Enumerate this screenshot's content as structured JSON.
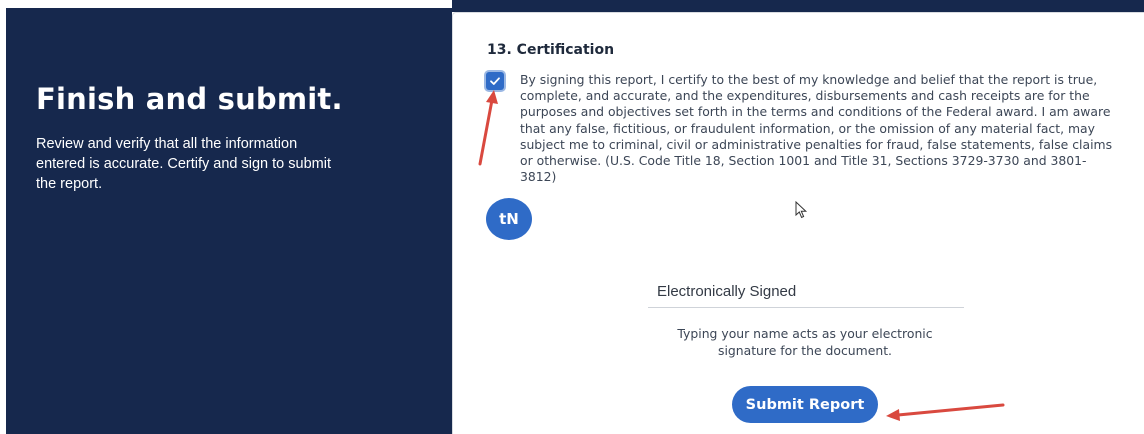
{
  "left": {
    "title": "Finish and submit.",
    "description": "Review and verify that all the information entered is accurate. Certify and sign to submit the report."
  },
  "certification": {
    "section_title": "13. Certification",
    "checked": true,
    "text": "By signing this report, I certify to the best of my knowledge and belief that the report is true, complete, and accurate, and the expenditures, disbursements and cash receipts are for the purposes and objectives set forth in the terms and conditions of the Federal award. I am aware that any false, fictitious, or fraudulent information, or the omission of any material fact, may subject me to criminal, civil or administrative penalties for fraud, false statements, false claims or otherwise. (U.S. Code Title 18, Section 1001 and Title 31, Sections 3729-3730 and 3801-3812)"
  },
  "avatar": {
    "initials": "tN"
  },
  "signature": {
    "value": "Electronically Signed",
    "help_text": "Typing your name acts as your electronic signature for the document."
  },
  "submit": {
    "label": "Submit Report"
  },
  "colors": {
    "left_panel": "#16284d",
    "accent": "#2f6bc7",
    "annotation_arrow": "#d9493f"
  },
  "icons": {
    "checkbox": "checkmark-icon",
    "cursor": "mouse-cursor-icon"
  }
}
